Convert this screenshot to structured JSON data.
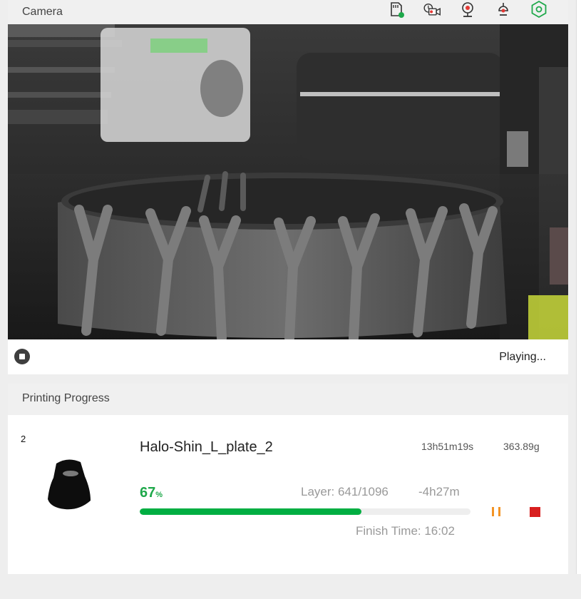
{
  "camera": {
    "title": "Camera",
    "icons": [
      "sd-card-icon",
      "timelapse-video-icon",
      "webcam-icon",
      "lamp-icon",
      "settings-hex-icon"
    ],
    "status": "Playing...",
    "accent_color": "#1ea84a",
    "alert_color": "#e53935"
  },
  "progress": {
    "title": "Printing Progress",
    "plate_number": "2",
    "job_name": "Halo-Shin_L_plate_2",
    "duration": "13h51m19s",
    "weight": "363.89g",
    "percent_value": "67",
    "percent_unit": "%",
    "fraction": 0.67,
    "layer": "Layer: 641/1096",
    "remaining": "-4h27m",
    "finish_time": "Finish Time: 16:02",
    "bar_color": "#00ae42",
    "pause_color": "#f39425",
    "stop_color": "#d81f1f"
  }
}
